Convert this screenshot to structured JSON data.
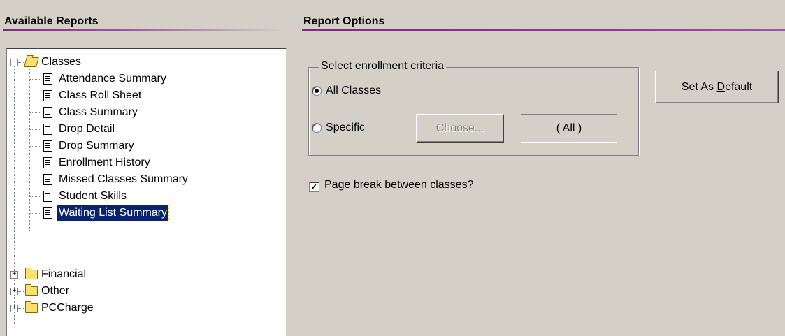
{
  "headers": {
    "available_reports": "Available Reports",
    "report_options": "Report Options"
  },
  "tree": {
    "classes_label": "Classes",
    "class_reports": [
      "Attendance Summary",
      "Class Roll Sheet",
      "Class Summary",
      "Drop Detail",
      "Drop Summary",
      "Enrollment History",
      "Missed Classes Summary",
      "Student Skills",
      "Waiting List Summary"
    ],
    "selected": "Waiting List Summary",
    "folders": [
      "Financial",
      "Other",
      "PCCharge"
    ]
  },
  "options": {
    "group_label": "Select enrollment criteria",
    "radio_all": "All Classes",
    "radio_specific": "Specific",
    "radio_selected": "All Classes",
    "choose_button": "Choose...",
    "specific_value": "( All )",
    "set_default_prefix": "Set As ",
    "set_default_accel": "D",
    "set_default_suffix": "efault",
    "page_break_label": "Page break between classes?",
    "page_break_checked": true
  },
  "icons": {
    "expanded": "minus-expander-icon",
    "collapsed": "plus-expander-icon",
    "folder_open": "open-folder-icon",
    "folder_closed": "folder-icon",
    "report": "report-document-icon"
  },
  "colors": {
    "face": "#d4d0c8",
    "selection": "#0a246a",
    "header_underline": "#7a2a7a"
  }
}
